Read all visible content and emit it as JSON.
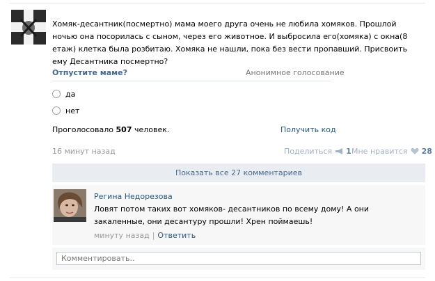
{
  "post": {
    "text": "Хомяк-десантник(посмертно) мама моего друга очень не любила хомяков. Прошлой ночью она посорилась с сыном, через его животное. И выбросила его(хомяка) с окна(8 етаж) клетка была розбитаю. Хомяка не нашли, пока без вести пропавший. Присвоить ему Десантника посмертно?",
    "time": "16 минут назад",
    "share_label": "Поделиться",
    "share_count": "1",
    "like_label": "Мне нравится",
    "like_count": "28"
  },
  "poll": {
    "question": "Отпустите маме?",
    "type": "Анонимное голосование",
    "options": [
      "да",
      "нет"
    ],
    "votes_prefix": "Проголосовало",
    "votes_count": "507",
    "votes_suffix": "человек.",
    "get_code": "Получить код"
  },
  "comments": {
    "show_all": "Показать все 27 комментариев",
    "items": [
      {
        "author": "Регина Недорезова",
        "text": "Ловят потом таких вот хомяков- десантников по всему дому! А они закаленные, они десантуру прошли! Хрен поймаешь!",
        "time": "минуту назад",
        "reply": "Ответить"
      }
    ],
    "input_placeholder": "Комментировать.."
  }
}
